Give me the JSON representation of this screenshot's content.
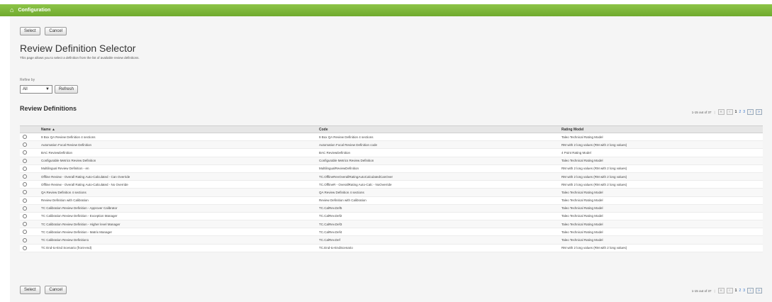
{
  "header": {
    "title": "Configuration",
    "icon": "home-icon",
    "accent_color": "#7ab83a"
  },
  "actions": {
    "select_label": "Select",
    "cancel_label": "Cancel"
  },
  "page": {
    "title": "Review Definition Selector",
    "description": "This page allows you to select a definition from the list of available review definitions."
  },
  "refine": {
    "label": "Refine by",
    "selected": "All",
    "refresh_label": "Refresh"
  },
  "section": {
    "title": "Review Definitions"
  },
  "pagination": {
    "summary": "1-15 out of 37",
    "pages": [
      "1",
      "2",
      "3"
    ],
    "current_page": "1"
  },
  "table": {
    "columns": [
      "Name ▲",
      "Code",
      "Rating Model"
    ],
    "rows": [
      [
        "9 Box QA Review Definition 4 sections",
        "9 Box QA Review Definition 4 sections",
        "Taleo Technical Rating Model"
      ],
      [
        "Automation Focal Review Definition",
        "Automation Focal Review Definition code",
        "RM with 2 long values (RM with 2 long values)"
      ],
      [
        "BAC ReviewDefinition",
        "BAC ReviewDefinition",
        "4 Point Rating Model"
      ],
      [
        "Configurable Metrics Review Definition",
        "Configurable Metrics Review Definition",
        "Taleo Technical Rating Model"
      ],
      [
        "Multilingual Review Definition - en",
        "MultilingualReviewDefinition",
        "RM with 2 long values (RM with 2 long values)"
      ],
      [
        "Offline Review - Overall Rating Auto-Calculated - Can Override",
        "TC.OfflineRevOverallRatingAutoCalculatedCanOver",
        "RM with 2 long values (RM with 2 long values)"
      ],
      [
        "Offline Review - Overall Rating Auto-Calculated - No Override",
        "TC.OfflineR - OverallRating Auto-Calc - NoOverride",
        "RM with 2 long values (RM with 2 long values)"
      ],
      [
        "QA Review Definition 4 sections",
        "QA Review Definition 4 sections",
        "Taleo Technical Rating Model"
      ],
      [
        "Review Definition with Calibration",
        "Review Definition with Calibration",
        "Taleo Technical Rating Model"
      ],
      [
        "TC Calibration Review Definition - Approver Calibrator",
        "TC.CalRev.Def5",
        "Taleo Technical Rating Model"
      ],
      [
        "TC Calibration Review Definition - Exception Manager",
        "TC.CalRev.Def2",
        "Taleo Technical Rating Model"
      ],
      [
        "TC Calibration Review Definition - Higher level Manager",
        "TC.CalRev.Def3",
        "Taleo Technical Rating Model"
      ],
      [
        "TC Calibration Review Definition - Matrix Manager",
        "TC.CalRev.Def4",
        "Taleo Technical Rating Model"
      ],
      [
        "TC Calibration Review Definition1",
        "TC.CalRev.Def",
        "Taleo Technical Rating Model"
      ],
      [
        "TC End-to-End Scenario (front-end)",
        "TC.End-to-EndScenario",
        "RM with 2 long values (RM with 2 long values)"
      ]
    ]
  }
}
